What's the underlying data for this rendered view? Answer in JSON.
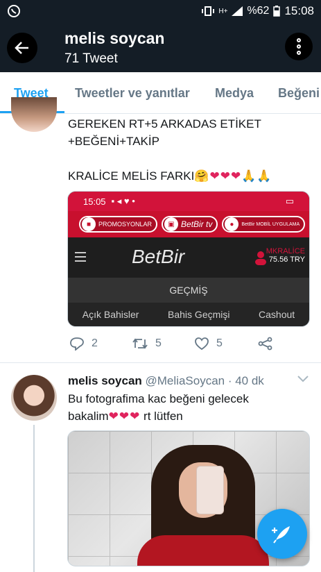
{
  "status_bar": {
    "left_icon": "whatsapp-icon",
    "network": "H+",
    "battery": "%62",
    "time": "15:08"
  },
  "header": {
    "title": "melis soycan",
    "subtitle": "71 Tweet"
  },
  "tabs": [
    {
      "label": "Tweet",
      "active": true
    },
    {
      "label": "Tweetler ve yanıtlar",
      "active": false
    },
    {
      "label": "Medya",
      "active": false
    },
    {
      "label": "Beğeni",
      "active": false
    }
  ],
  "tweet1": {
    "line1": "GEREKEN RT+5 ARKADAS ETİKET",
    "line2": "+BEĞENİ+TAKİP",
    "line3": "KRALİCE MELİS FARKI",
    "emoji": "🤗❤❤❤🙏🙏",
    "embed": {
      "time": "15:05",
      "promo_items": [
        "PROMOSYONLAR",
        "BetBir tv",
        "BetBir MOBİL UYGULAMA"
      ],
      "logo": "BetBir",
      "username": "MKRALİCE",
      "balance": "75.56 TRY",
      "section": "GEÇMİŞ",
      "subtabs": [
        "Açık Bahisler",
        "Bahis Geçmişi",
        "Cashout"
      ]
    },
    "actions": {
      "replies": "2",
      "retweets": "5",
      "likes": "5"
    }
  },
  "tweet2": {
    "name": "melis soycan",
    "handle": "@MeliaSoycan · 40 dk",
    "text_line1": "Bu fotografima kac beğeni gelecek",
    "text_line2a": "bakalim",
    "hearts": "❤❤❤",
    "text_line2b": " rt lütfen"
  },
  "colors": {
    "accent": "#1da1f2",
    "header_bg": "#141d26",
    "heart": "#e0245e",
    "betbir_red": "#d2133a"
  }
}
